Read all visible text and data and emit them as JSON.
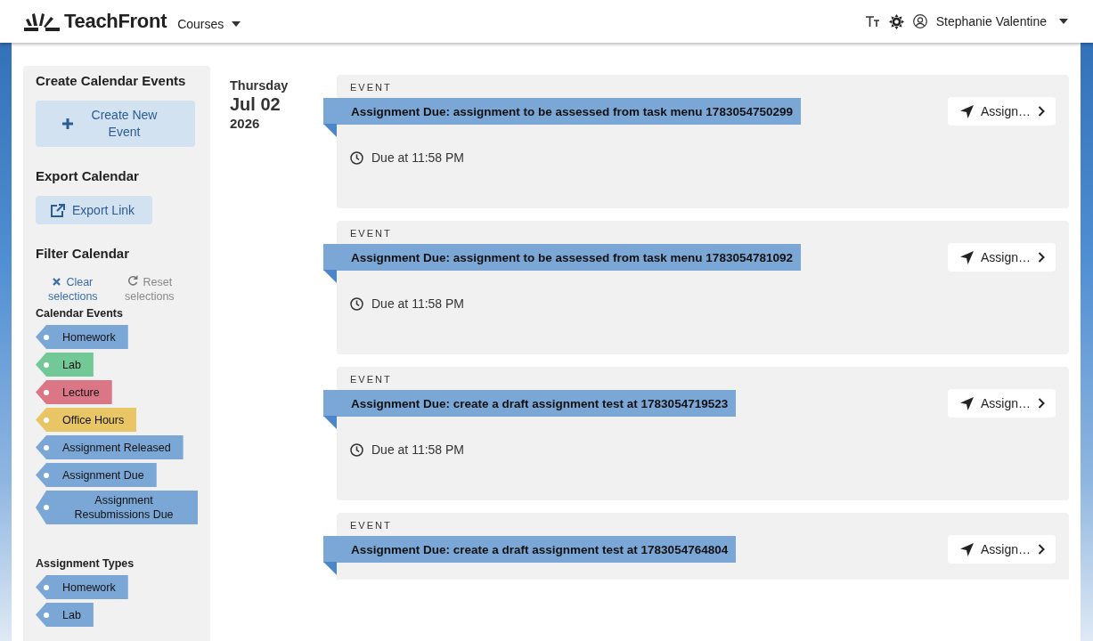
{
  "header": {
    "brand": "TeachFront",
    "courses_menu": "Courses",
    "user_name": "Stephanie Valentine"
  },
  "sidebar": {
    "create_heading": "Create Calendar Events",
    "create_button": "Create New Event",
    "export_heading": "Export Calendar",
    "export_button": "Export Link",
    "filter_heading": "Filter Calendar",
    "clear_button": "Clear selections",
    "reset_button": "Reset selections",
    "groups": [
      {
        "heading": "Calendar Events",
        "tags": [
          {
            "label": "Homework",
            "color": "#7ba7d7"
          },
          {
            "label": "Lab",
            "color": "#72c997"
          },
          {
            "label": "Lecture",
            "color": "#db7687"
          },
          {
            "label": "Office Hours",
            "color": "#e8c565"
          },
          {
            "label": "Assignment Released",
            "color": "#7ba7d7"
          },
          {
            "label": "Assignment Due",
            "color": "#7ba7d7"
          },
          {
            "label": "Assignment Resubmissions Due",
            "color": "#7ba7d7"
          }
        ]
      },
      {
        "heading": "Assignment Types",
        "tags": [
          {
            "label": "Homework",
            "color": "#7ba7d7"
          },
          {
            "label": "Lab",
            "color": "#7ba7d7"
          }
        ]
      }
    ]
  },
  "date": {
    "weekday": "Thursday",
    "day": "Jul 02",
    "year": "2026"
  },
  "events": [
    {
      "label": "EVENT",
      "title": "Assignment Due: assignment to be assessed from task menu 1783054750299",
      "due": "Due at 11:58 PM",
      "action": "Assign…"
    },
    {
      "label": "EVENT",
      "title": "Assignment Due: assignment to be assessed from task menu 1783054781092",
      "due": "Due at 11:58 PM",
      "action": "Assign…"
    },
    {
      "label": "EVENT",
      "title": "Assignment Due: create a draft assignment test at 1783054719523",
      "due": "Due at 11:58 PM",
      "action": "Assign…"
    },
    {
      "label": "EVENT",
      "title": "Assignment Due: create a draft assignment test at 1783054764804",
      "action": "Assign…"
    }
  ]
}
